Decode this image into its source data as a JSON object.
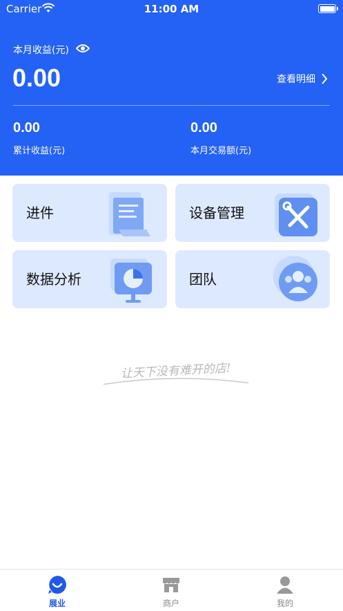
{
  "status_bar": {
    "carrier": "Carrier",
    "time": "11:00 AM"
  },
  "earnings": {
    "month_label": "本月收益(元)",
    "month_amount": "0.00",
    "detail_link": "查看明细",
    "total_value": "0.00",
    "total_label": "累计收益(元)",
    "volume_value": "0.00",
    "volume_label": "本月交易额(元)"
  },
  "menu": {
    "incoming": "进件",
    "devices": "设备管理",
    "analytics": "数据分析",
    "team": "团队"
  },
  "slogan": "让天下没有难开的店!",
  "tabs": {
    "home": "展业",
    "merchants": "商户",
    "mine": "我的"
  },
  "colors": {
    "primary": "#2461f5",
    "card_bg": "#dde9ff",
    "tab_active": "#1f5ae6"
  },
  "icons": {
    "eye": "eye-icon",
    "chevron": "chevron-right-icon",
    "incoming": "document-icon",
    "devices": "tools-icon",
    "analytics": "pie-chart-icon",
    "team": "users-icon",
    "home": "smile-icon",
    "merchants": "store-icon",
    "mine": "person-icon"
  }
}
